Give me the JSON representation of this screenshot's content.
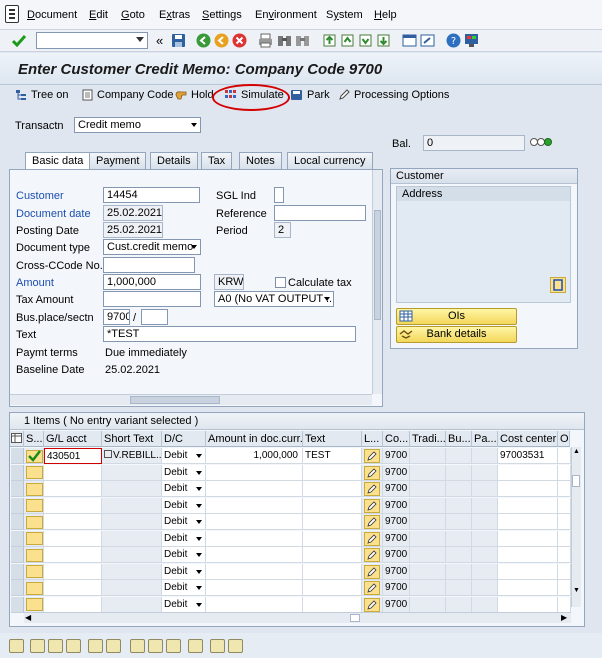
{
  "menu": [
    "Document",
    "Edit",
    "Goto",
    "Extras",
    "Settings",
    "Environment",
    "System",
    "Help"
  ],
  "menu_underline": [
    "D",
    "E",
    "G",
    "x",
    "S",
    "v",
    "y",
    "H"
  ],
  "title": "Enter Customer Credit Memo: Company Code 9700",
  "app_toolbar": {
    "tree_on": "Tree on",
    "company_code": "Company Code",
    "hold": "Hold",
    "simulate": "Simulate",
    "park": "Park",
    "processing_options": "Processing Options"
  },
  "header": {
    "transactn_label": "Transactn",
    "transactn_value": "Credit memo",
    "bal_label": "Bal.",
    "bal_value": "0"
  },
  "tabs": [
    "Basic data",
    "Payment",
    "Details",
    "Tax",
    "Notes",
    "Local currency"
  ],
  "basic": {
    "customer_label": "Customer",
    "customer_value": "14454",
    "sgl_label": "SGL Ind",
    "docdate_label": "Document date",
    "docdate_value": "25.02.2021",
    "reference_label": "Reference",
    "postdate_label": "Posting Date",
    "postdate_value": "25.02.2021",
    "period_label": "Period",
    "period_value": "2",
    "doctype_label": "Document type",
    "doctype_value": "Cust.credit memo",
    "crossc_label": "Cross-CCode No.",
    "amount_label": "Amount",
    "amount_value": "1,000,000",
    "currency": "KRW",
    "calc_tax_label": "Calculate tax",
    "taxamt_label": "Tax Amount",
    "taxcode_value": "A0 (No VAT OUTPUT ...",
    "busplace_label": "Bus.place/sectn",
    "busplace_value": "9700",
    "slash": "/",
    "text_label": "Text",
    "text_value": "*TEST",
    "paymt_label": "Paymt terms",
    "paymt_value": "Due immediately",
    "baseline_label": "Baseline Date",
    "baseline_value": "25.02.2021"
  },
  "customer_box": {
    "title": "Customer",
    "address": "Address",
    "ois": "OIs",
    "bank": "Bank details"
  },
  "items": {
    "title": "1 Items ( No entry variant selected )",
    "columns": [
      "S...",
      "G/L acct",
      "Short Text",
      "D/C",
      "Amount in doc.curr.",
      "Text",
      "L...",
      "Co...",
      "Tradi...",
      "Bu...",
      "Pa...",
      "Cost center",
      "Or"
    ],
    "rows": [
      {
        "gl": "430501",
        "short": "V.REBILL...",
        "dc": "Debit",
        "amount": "1,000,000",
        "text": "TEST",
        "co": "9700",
        "cost": "97003531"
      },
      {
        "gl": "",
        "short": "",
        "dc": "Debit",
        "amount": "",
        "text": "",
        "co": "9700",
        "cost": ""
      },
      {
        "gl": "",
        "short": "",
        "dc": "Debit",
        "amount": "",
        "text": "",
        "co": "9700",
        "cost": ""
      },
      {
        "gl": "",
        "short": "",
        "dc": "Debit",
        "amount": "",
        "text": "",
        "co": "9700",
        "cost": ""
      },
      {
        "gl": "",
        "short": "",
        "dc": "Debit",
        "amount": "",
        "text": "",
        "co": "9700",
        "cost": ""
      },
      {
        "gl": "",
        "short": "",
        "dc": "Debit",
        "amount": "",
        "text": "",
        "co": "9700",
        "cost": ""
      },
      {
        "gl": "",
        "short": "",
        "dc": "Debit",
        "amount": "",
        "text": "",
        "co": "9700",
        "cost": ""
      },
      {
        "gl": "",
        "short": "",
        "dc": "Debit",
        "amount": "",
        "text": "",
        "co": "9700",
        "cost": ""
      },
      {
        "gl": "",
        "short": "",
        "dc": "Debit",
        "amount": "",
        "text": "",
        "co": "9700",
        "cost": ""
      },
      {
        "gl": "",
        "short": "",
        "dc": "Debit",
        "amount": "",
        "text": "",
        "co": "9700",
        "cost": ""
      }
    ]
  },
  "colors": {
    "label_blue": "#1c4fb0",
    "highlight_red": "#d40000",
    "yellow": "#fbe08d"
  }
}
